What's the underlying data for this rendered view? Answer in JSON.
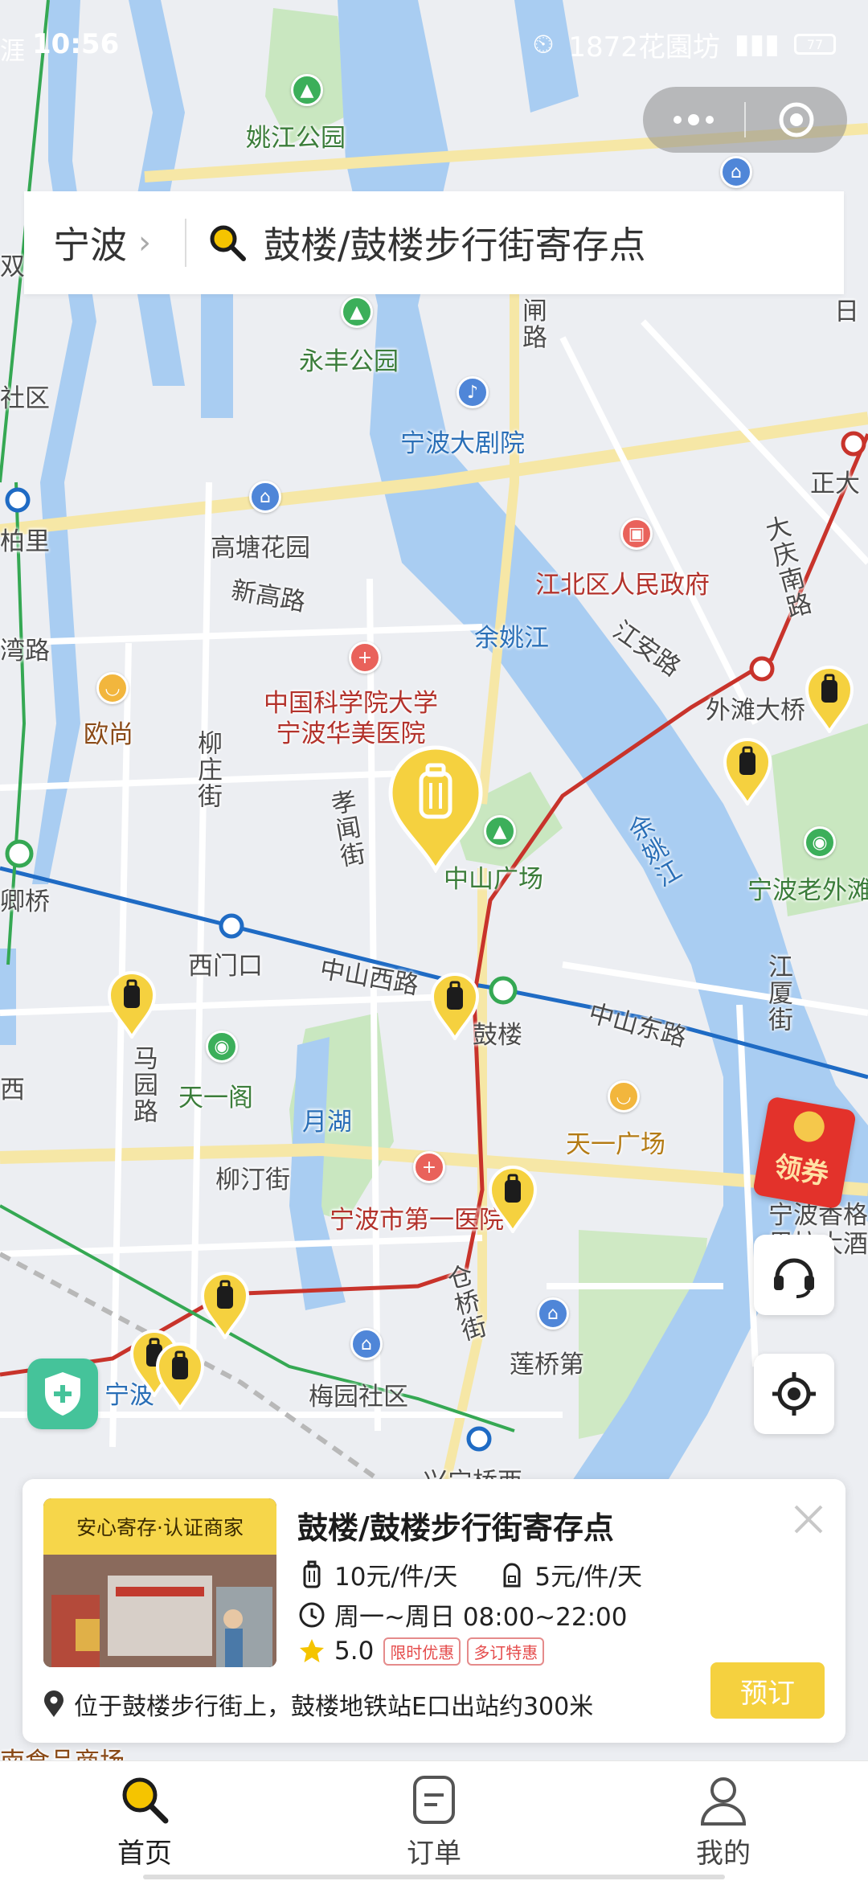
{
  "status_bar": {
    "time": "10:56",
    "overlay_text": "1872花園坊",
    "battery": "77"
  },
  "search": {
    "city": "宁波",
    "query": "鼓楼/鼓楼步行街寄存点"
  },
  "map_labels": {
    "yaojiang_park": "姚江公园",
    "yongfeng_park": "永丰公园",
    "grand_theatre": "宁波大剧院",
    "gaotang_garden": "高塘花园",
    "xingao_road": "新高路",
    "jiangbei_gov": "江北区人民政府",
    "yuyao_river": "余姚江",
    "yuyao_river_2": "余姚江",
    "jiangan_road": "江安路",
    "hospital": "中国科学院大学\n宁波华美医院",
    "ou_shang": "欧尚",
    "liuzhuang_street": "柳庄街",
    "xiaowen_street": "孝闻街",
    "zhongshan_square": "中山广场",
    "waitan_bridge": "外滩大桥",
    "ningbo_old_bund": "宁波老外滩",
    "zhengda": "正大",
    "dagong_road": "大庆南路",
    "ximenkou": "西门口",
    "zhongshan_west": "中山西路",
    "zhongshan_east": "中山东路",
    "gulou": "鼓楼",
    "jiangxia_street": "江厦街",
    "tianyige": "天一阁",
    "malu_road": "马园路",
    "yuehu": "月湖",
    "tianyi_square": "天一广场",
    "liuting_street": "柳汀街",
    "first_hospital": "宁波市第一医院",
    "cangqiao_street": "仓桥街",
    "lianqiao": "莲桥第",
    "meiyuan": "梅园社区",
    "ningbo_station": "宁波",
    "xingning_bridge": "兴宁桥西",
    "food_mall": "南食品商场",
    "left_community": "社区",
    "left_baili": "柏里",
    "left_wanlu": "湾路",
    "left_qingqiao": "卿桥",
    "left_xi": "西",
    "left_shuang": "双",
    "ningbo_xiangge": "宁波香格里拉大酒店",
    "top_left": "涯",
    "right_ri": "日",
    "zha_road": "闸路"
  },
  "coupon_label": "领券",
  "card": {
    "badge": "安心寄存·认证商家",
    "title": "鼓楼/鼓楼步行街寄存点",
    "price_piece": "10元/件/天",
    "price_bag": "5元/件/天",
    "hours": "周一~周日 08:00~22:00",
    "rating": "5.0",
    "tag1": "限时优惠",
    "tag2": "多订特惠",
    "address": "位于鼓楼步行街上，鼓楼地铁站E口出站约300米",
    "book_button": "预订"
  },
  "tabs": [
    {
      "label": "首页",
      "icon": "search-icon"
    },
    {
      "label": "订单",
      "icon": "order-icon"
    },
    {
      "label": "我的",
      "icon": "user-icon"
    }
  ],
  "colors": {
    "accent": "#f5d13f",
    "pin": "#f5d13f",
    "metro_blue": "#1f6bc4",
    "metro_red": "#c8332b",
    "rail_green": "#35a853"
  }
}
